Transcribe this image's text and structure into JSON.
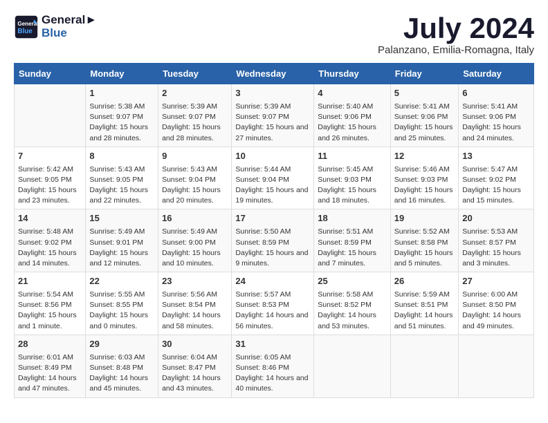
{
  "logo": {
    "line1": "General",
    "line2": "Blue"
  },
  "title": "July 2024",
  "subtitle": "Palanzano, Emilia-Romagna, Italy",
  "days_of_week": [
    "Sunday",
    "Monday",
    "Tuesday",
    "Wednesday",
    "Thursday",
    "Friday",
    "Saturday"
  ],
  "weeks": [
    [
      {
        "day": "",
        "sunrise": "",
        "sunset": "",
        "daylight": ""
      },
      {
        "day": "1",
        "sunrise": "Sunrise: 5:38 AM",
        "sunset": "Sunset: 9:07 PM",
        "daylight": "Daylight: 15 hours and 28 minutes."
      },
      {
        "day": "2",
        "sunrise": "Sunrise: 5:39 AM",
        "sunset": "Sunset: 9:07 PM",
        "daylight": "Daylight: 15 hours and 28 minutes."
      },
      {
        "day": "3",
        "sunrise": "Sunrise: 5:39 AM",
        "sunset": "Sunset: 9:07 PM",
        "daylight": "Daylight: 15 hours and 27 minutes."
      },
      {
        "day": "4",
        "sunrise": "Sunrise: 5:40 AM",
        "sunset": "Sunset: 9:06 PM",
        "daylight": "Daylight: 15 hours and 26 minutes."
      },
      {
        "day": "5",
        "sunrise": "Sunrise: 5:41 AM",
        "sunset": "Sunset: 9:06 PM",
        "daylight": "Daylight: 15 hours and 25 minutes."
      },
      {
        "day": "6",
        "sunrise": "Sunrise: 5:41 AM",
        "sunset": "Sunset: 9:06 PM",
        "daylight": "Daylight: 15 hours and 24 minutes."
      }
    ],
    [
      {
        "day": "7",
        "sunrise": "Sunrise: 5:42 AM",
        "sunset": "Sunset: 9:05 PM",
        "daylight": "Daylight: 15 hours and 23 minutes."
      },
      {
        "day": "8",
        "sunrise": "Sunrise: 5:43 AM",
        "sunset": "Sunset: 9:05 PM",
        "daylight": "Daylight: 15 hours and 22 minutes."
      },
      {
        "day": "9",
        "sunrise": "Sunrise: 5:43 AM",
        "sunset": "Sunset: 9:04 PM",
        "daylight": "Daylight: 15 hours and 20 minutes."
      },
      {
        "day": "10",
        "sunrise": "Sunrise: 5:44 AM",
        "sunset": "Sunset: 9:04 PM",
        "daylight": "Daylight: 15 hours and 19 minutes."
      },
      {
        "day": "11",
        "sunrise": "Sunrise: 5:45 AM",
        "sunset": "Sunset: 9:03 PM",
        "daylight": "Daylight: 15 hours and 18 minutes."
      },
      {
        "day": "12",
        "sunrise": "Sunrise: 5:46 AM",
        "sunset": "Sunset: 9:03 PM",
        "daylight": "Daylight: 15 hours and 16 minutes."
      },
      {
        "day": "13",
        "sunrise": "Sunrise: 5:47 AM",
        "sunset": "Sunset: 9:02 PM",
        "daylight": "Daylight: 15 hours and 15 minutes."
      }
    ],
    [
      {
        "day": "14",
        "sunrise": "Sunrise: 5:48 AM",
        "sunset": "Sunset: 9:02 PM",
        "daylight": "Daylight: 15 hours and 14 minutes."
      },
      {
        "day": "15",
        "sunrise": "Sunrise: 5:49 AM",
        "sunset": "Sunset: 9:01 PM",
        "daylight": "Daylight: 15 hours and 12 minutes."
      },
      {
        "day": "16",
        "sunrise": "Sunrise: 5:49 AM",
        "sunset": "Sunset: 9:00 PM",
        "daylight": "Daylight: 15 hours and 10 minutes."
      },
      {
        "day": "17",
        "sunrise": "Sunrise: 5:50 AM",
        "sunset": "Sunset: 8:59 PM",
        "daylight": "Daylight: 15 hours and 9 minutes."
      },
      {
        "day": "18",
        "sunrise": "Sunrise: 5:51 AM",
        "sunset": "Sunset: 8:59 PM",
        "daylight": "Daylight: 15 hours and 7 minutes."
      },
      {
        "day": "19",
        "sunrise": "Sunrise: 5:52 AM",
        "sunset": "Sunset: 8:58 PM",
        "daylight": "Daylight: 15 hours and 5 minutes."
      },
      {
        "day": "20",
        "sunrise": "Sunrise: 5:53 AM",
        "sunset": "Sunset: 8:57 PM",
        "daylight": "Daylight: 15 hours and 3 minutes."
      }
    ],
    [
      {
        "day": "21",
        "sunrise": "Sunrise: 5:54 AM",
        "sunset": "Sunset: 8:56 PM",
        "daylight": "Daylight: 15 hours and 1 minute."
      },
      {
        "day": "22",
        "sunrise": "Sunrise: 5:55 AM",
        "sunset": "Sunset: 8:55 PM",
        "daylight": "Daylight: 15 hours and 0 minutes."
      },
      {
        "day": "23",
        "sunrise": "Sunrise: 5:56 AM",
        "sunset": "Sunset: 8:54 PM",
        "daylight": "Daylight: 14 hours and 58 minutes."
      },
      {
        "day": "24",
        "sunrise": "Sunrise: 5:57 AM",
        "sunset": "Sunset: 8:53 PM",
        "daylight": "Daylight: 14 hours and 56 minutes."
      },
      {
        "day": "25",
        "sunrise": "Sunrise: 5:58 AM",
        "sunset": "Sunset: 8:52 PM",
        "daylight": "Daylight: 14 hours and 53 minutes."
      },
      {
        "day": "26",
        "sunrise": "Sunrise: 5:59 AM",
        "sunset": "Sunset: 8:51 PM",
        "daylight": "Daylight: 14 hours and 51 minutes."
      },
      {
        "day": "27",
        "sunrise": "Sunrise: 6:00 AM",
        "sunset": "Sunset: 8:50 PM",
        "daylight": "Daylight: 14 hours and 49 minutes."
      }
    ],
    [
      {
        "day": "28",
        "sunrise": "Sunrise: 6:01 AM",
        "sunset": "Sunset: 8:49 PM",
        "daylight": "Daylight: 14 hours and 47 minutes."
      },
      {
        "day": "29",
        "sunrise": "Sunrise: 6:03 AM",
        "sunset": "Sunset: 8:48 PM",
        "daylight": "Daylight: 14 hours and 45 minutes."
      },
      {
        "day": "30",
        "sunrise": "Sunrise: 6:04 AM",
        "sunset": "Sunset: 8:47 PM",
        "daylight": "Daylight: 14 hours and 43 minutes."
      },
      {
        "day": "31",
        "sunrise": "Sunrise: 6:05 AM",
        "sunset": "Sunset: 8:46 PM",
        "daylight": "Daylight: 14 hours and 40 minutes."
      },
      {
        "day": "",
        "sunrise": "",
        "sunset": "",
        "daylight": ""
      },
      {
        "day": "",
        "sunrise": "",
        "sunset": "",
        "daylight": ""
      },
      {
        "day": "",
        "sunrise": "",
        "sunset": "",
        "daylight": ""
      }
    ]
  ]
}
